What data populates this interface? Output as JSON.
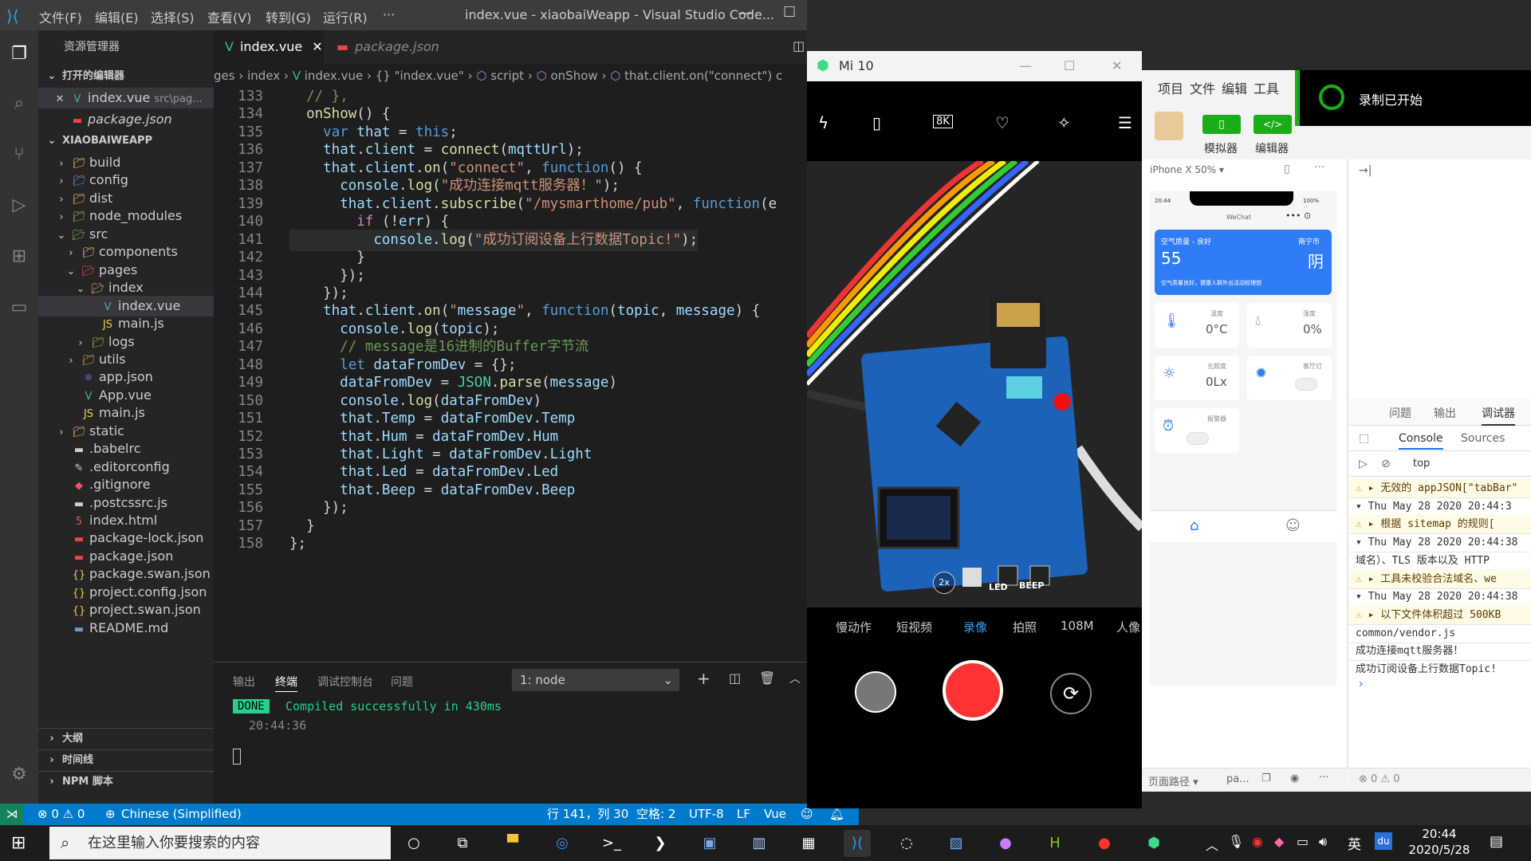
{
  "vscode": {
    "menu": [
      "文件(F)",
      "编辑(E)",
      "选择(S)",
      "查看(V)",
      "转到(G)",
      "运行(R)",
      "···"
    ],
    "window_title": "index.vue - xiaobaiWeapp - Visual Studio Code...",
    "explorer_title": "资源管理器",
    "open_editors_label": "打开的编辑器",
    "open_editors": [
      {
        "name": "index.vue",
        "path": "src\\pag..."
      },
      {
        "name": "package.json",
        "path": ""
      }
    ],
    "project_label": "XIAOBAIWEAPP",
    "tree": [
      "build",
      "config",
      "dist",
      "node_modules",
      "src",
      "components",
      "pages",
      "index",
      "index.vue",
      "main.js",
      "logs",
      "utils",
      "app.json",
      "App.vue",
      "main.js",
      "static",
      ".babelrc",
      ".editorconfig",
      ".gitignore",
      ".postcssrc.js",
      "index.html",
      "package-lock.json",
      "package.json",
      "package.swan.json",
      "project.config.json",
      "project.swan.json",
      "README.md"
    ],
    "outline_label": "大纲",
    "timeline_label": "时间线",
    "npm_label": "NPM 脚本",
    "tabs": [
      "index.vue",
      "package.json"
    ],
    "breadcrumb": [
      "ges",
      "index",
      "index.vue",
      "{} \"index.vue\"",
      "script",
      "onShow",
      "that.client.on(\"connect\") c"
    ],
    "line_numbers": [
      "133",
      "134",
      "135",
      "136",
      "137",
      "138",
      "139",
      "140",
      "141",
      "142",
      "143",
      "144",
      "145",
      "146",
      "147",
      "148",
      "149",
      "150",
      "151",
      "152",
      "153",
      "154",
      "155",
      "156",
      "157",
      "158"
    ],
    "code": [
      "  // },",
      "  onShow() {",
      "    var that = this;",
      "    that.client = connect(mqttUrl);",
      "    that.client.on(\"connect\", function() {",
      "      console.log(\"成功连接mqtt服务器！\");",
      "      that.client.subscribe(\"/mysmarthome/pub\", function(e",
      "        if (!err) {",
      "          console.log(\"成功订阅设备上行数据Topic!\");",
      "        }",
      "      });",
      "    });",
      "    that.client.on(\"message\", function(topic, message) {",
      "      console.log(topic);",
      "      // message是16进制的Buffer字节流",
      "      let dataFromDev = {};",
      "      dataFromDev = JSON.parse(message)",
      "      console.log(dataFromDev)",
      "      that.Temp = dataFromDev.Temp",
      "      that.Hum = dataFromDev.Hum",
      "      that.Light = dataFromDev.Light",
      "      that.Led = dataFromDev.Led",
      "      that.Beep = dataFromDev.Beep",
      "    });",
      "  }",
      "};"
    ],
    "panel_tabs": [
      "输出",
      "终端",
      "调试控制台",
      "问题"
    ],
    "terminal_select": "1: node",
    "done_badge": "DONE",
    "compiled_msg": "Compiled successfully in 430ms",
    "compiled_time": "20:44:36",
    "status": {
      "errors": "⊗ 0 ⚠ 0",
      "language_pack": "Chinese (Simplified)",
      "position": "行 141，列 30",
      "spaces": "空格: 2",
      "encoding": "UTF-8",
      "eol": "LF",
      "lang": "Vue"
    }
  },
  "phone": {
    "title": "Mi 10",
    "camera_modes": [
      "慢动作",
      "短视频",
      "录像",
      "拍照",
      "108M",
      "人像"
    ],
    "zoom": "2x",
    "pcb_labels": [
      "LED",
      "BEEP"
    ]
  },
  "devtools": {
    "menu": [
      "项目",
      "文件",
      "编辑",
      "工具"
    ],
    "simulator_label": "模拟器",
    "editor_label": "编辑器",
    "recording": "录制已开始",
    "device": "iPhone X 50% ▾",
    "sim": {
      "time": "20:44",
      "battery": "100%",
      "nav_title": "WeChat",
      "air_quality_label": "空气质量 - 良好",
      "city": "南宁市",
      "aqi": "55",
      "weather": "阴",
      "tip": "空气质量良好，健康人群外出活动较理想",
      "temp_label": "温度",
      "temp_value": "0°C",
      "hum_label": "湿度",
      "hum_value": "0%",
      "light_label": "光照度",
      "light_value": "0Lx",
      "led_label": "客厅灯",
      "beep_label": "报警器"
    },
    "page_path": "页面路径 ▾",
    "page_path_val": "pa...",
    "debug_tabs": [
      "问题",
      "输出",
      "调试器"
    ],
    "console_tabs": [
      "Console",
      "Sources"
    ],
    "context": "top",
    "counts": "⊗ 0 ⚠ 0",
    "console": [
      {
        "type": "warn",
        "text": "▸ 无效的 appJSON[\"tabBar\""
      },
      {
        "type": "log",
        "text": "▾ Thu May 28 2020 20:44:3"
      },
      {
        "type": "warn",
        "text": "▸ 根据 sitemap 的规则["
      },
      {
        "type": "log",
        "text": "▾ Thu May 28 2020 20:44:38"
      },
      {
        "type": "log",
        "text": "域名）、TLS 版本以及 HTTP"
      },
      {
        "type": "warn",
        "text": "▸ 工具未校验合法域名、we"
      },
      {
        "type": "log",
        "text": "▾ Thu May 28 2020 20:44:38"
      },
      {
        "type": "warn",
        "text": "▸ 以下文件体积超过 500KB"
      },
      {
        "type": "log",
        "text": "  common/vendor.js"
      },
      {
        "type": "log",
        "text": "成功连接mqtt服务器！"
      },
      {
        "type": "log",
        "text": "成功订阅设备上行数据Topic!"
      }
    ]
  },
  "taskbar": {
    "search_placeholder": "在这里输入你要搜索的内容",
    "ime": "英",
    "time": "20:44",
    "date": "2020/5/28"
  }
}
